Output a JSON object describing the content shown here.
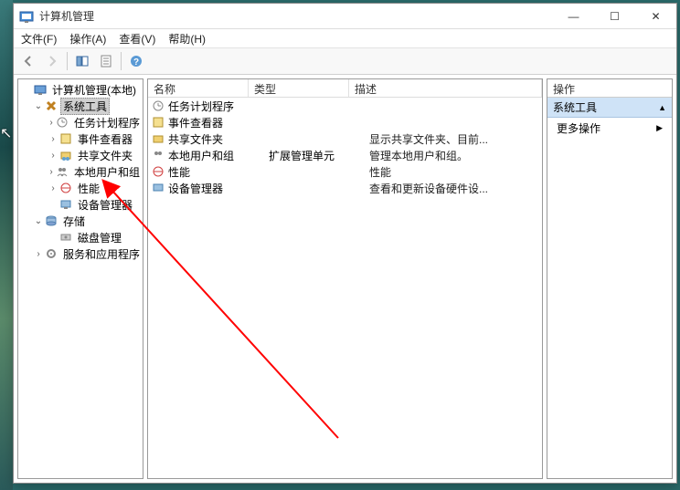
{
  "window": {
    "title": "计算机管理",
    "buttons": {
      "min": "—",
      "max": "☐",
      "close": "✕"
    }
  },
  "menu": {
    "file": "文件(F)",
    "action": "操作(A)",
    "view": "查看(V)",
    "help": "帮助(H)"
  },
  "tree": {
    "root": "计算机管理(本地)",
    "system_tools": "系统工具",
    "task_scheduler": "任务计划程序",
    "event_viewer": "事件查看器",
    "shared_folders": "共享文件夹",
    "local_users": "本地用户和组",
    "performance": "性能",
    "device_manager": "设备管理器",
    "storage": "存储",
    "disk_mgmt": "磁盘管理",
    "services_apps": "服务和应用程序"
  },
  "list": {
    "headers": {
      "name": "名称",
      "type": "类型",
      "desc": "描述"
    },
    "rows": [
      {
        "name": "任务计划程序",
        "type": "",
        "desc": ""
      },
      {
        "name": "事件查看器",
        "type": "",
        "desc": ""
      },
      {
        "name": "共享文件夹",
        "type": "",
        "desc": "显示共享文件夹、目前..."
      },
      {
        "name": "本地用户和组",
        "type": "扩展管理单元",
        "desc": "管理本地用户和组。"
      },
      {
        "name": "性能",
        "type": "",
        "desc": "性能"
      },
      {
        "name": "设备管理器",
        "type": "",
        "desc": "查看和更新设备硬件设..."
      }
    ]
  },
  "actions": {
    "header": "操作",
    "section": "系统工具",
    "more": "更多操作"
  }
}
